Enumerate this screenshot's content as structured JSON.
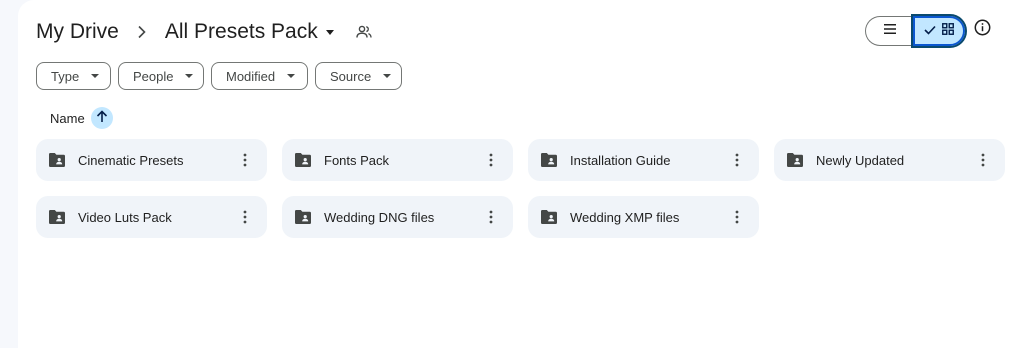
{
  "breadcrumb": {
    "root": "My Drive",
    "current": "All Presets Pack",
    "separator": "›"
  },
  "view_toggle": {
    "list_icon": "list-icon",
    "grid_icon": "grid-icon",
    "selected": "grid"
  },
  "filters": [
    {
      "label": "Type"
    },
    {
      "label": "People"
    },
    {
      "label": "Modified"
    },
    {
      "label": "Source"
    }
  ],
  "sort": {
    "label": "Name",
    "direction": "ascending"
  },
  "folders": [
    {
      "name": "Cinematic Presets"
    },
    {
      "name": "Fonts Pack"
    },
    {
      "name": "Installation Guide"
    },
    {
      "name": "Newly Updated"
    },
    {
      "name": "Video Luts Pack"
    },
    {
      "name": "Wedding DNG files"
    },
    {
      "name": "Wedding XMP files"
    }
  ],
  "colors": {
    "accent": "#0b57d0",
    "selected_bg": "#c2e7ff",
    "card_bg": "#f0f4f9"
  }
}
